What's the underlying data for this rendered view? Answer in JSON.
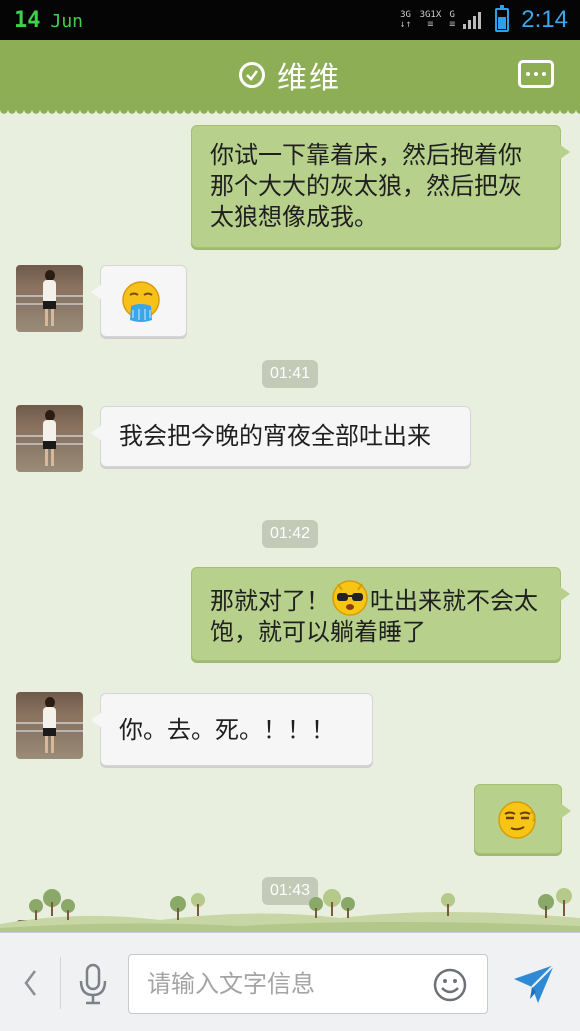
{
  "status_bar": {
    "day": "14",
    "month": "Jun",
    "net_label_1": "3G",
    "net_label_2": "3G",
    "net_label_3": "1X",
    "net_label_4": "G",
    "time": "2:14"
  },
  "header": {
    "title": "维维"
  },
  "messages": [
    {
      "direction": "out",
      "text": "你试一下靠着床，然后抱着你那个大大的灰太狼，然后把灰太狼想像成我。"
    },
    {
      "direction": "in",
      "emoji": "vomit-emoji"
    },
    {
      "timestamp": "01:41"
    },
    {
      "direction": "in",
      "text": "我会把今晚的宵夜全部吐出来"
    },
    {
      "timestamp": "01:42"
    },
    {
      "direction": "out",
      "text_before": "那就对了！",
      "emoji": "cool-sunglasses-emoji",
      "text_after": "吐出来就不会太饱，就可以躺着睡了"
    },
    {
      "direction": "in",
      "text": "你。去。死。！！！"
    },
    {
      "direction": "out",
      "emoji": "smug-emoji"
    },
    {
      "timestamp": "01:43"
    }
  ],
  "input": {
    "placeholder": "请输入文字信息"
  },
  "colors": {
    "header_green": "#8eae56",
    "outgoing_bubble": "#b7d08b",
    "incoming_bubble": "#f6f6f6",
    "chat_background": "#e9efdf",
    "clock_blue": "#3aa8ee",
    "date_green": "#3ed14a"
  }
}
